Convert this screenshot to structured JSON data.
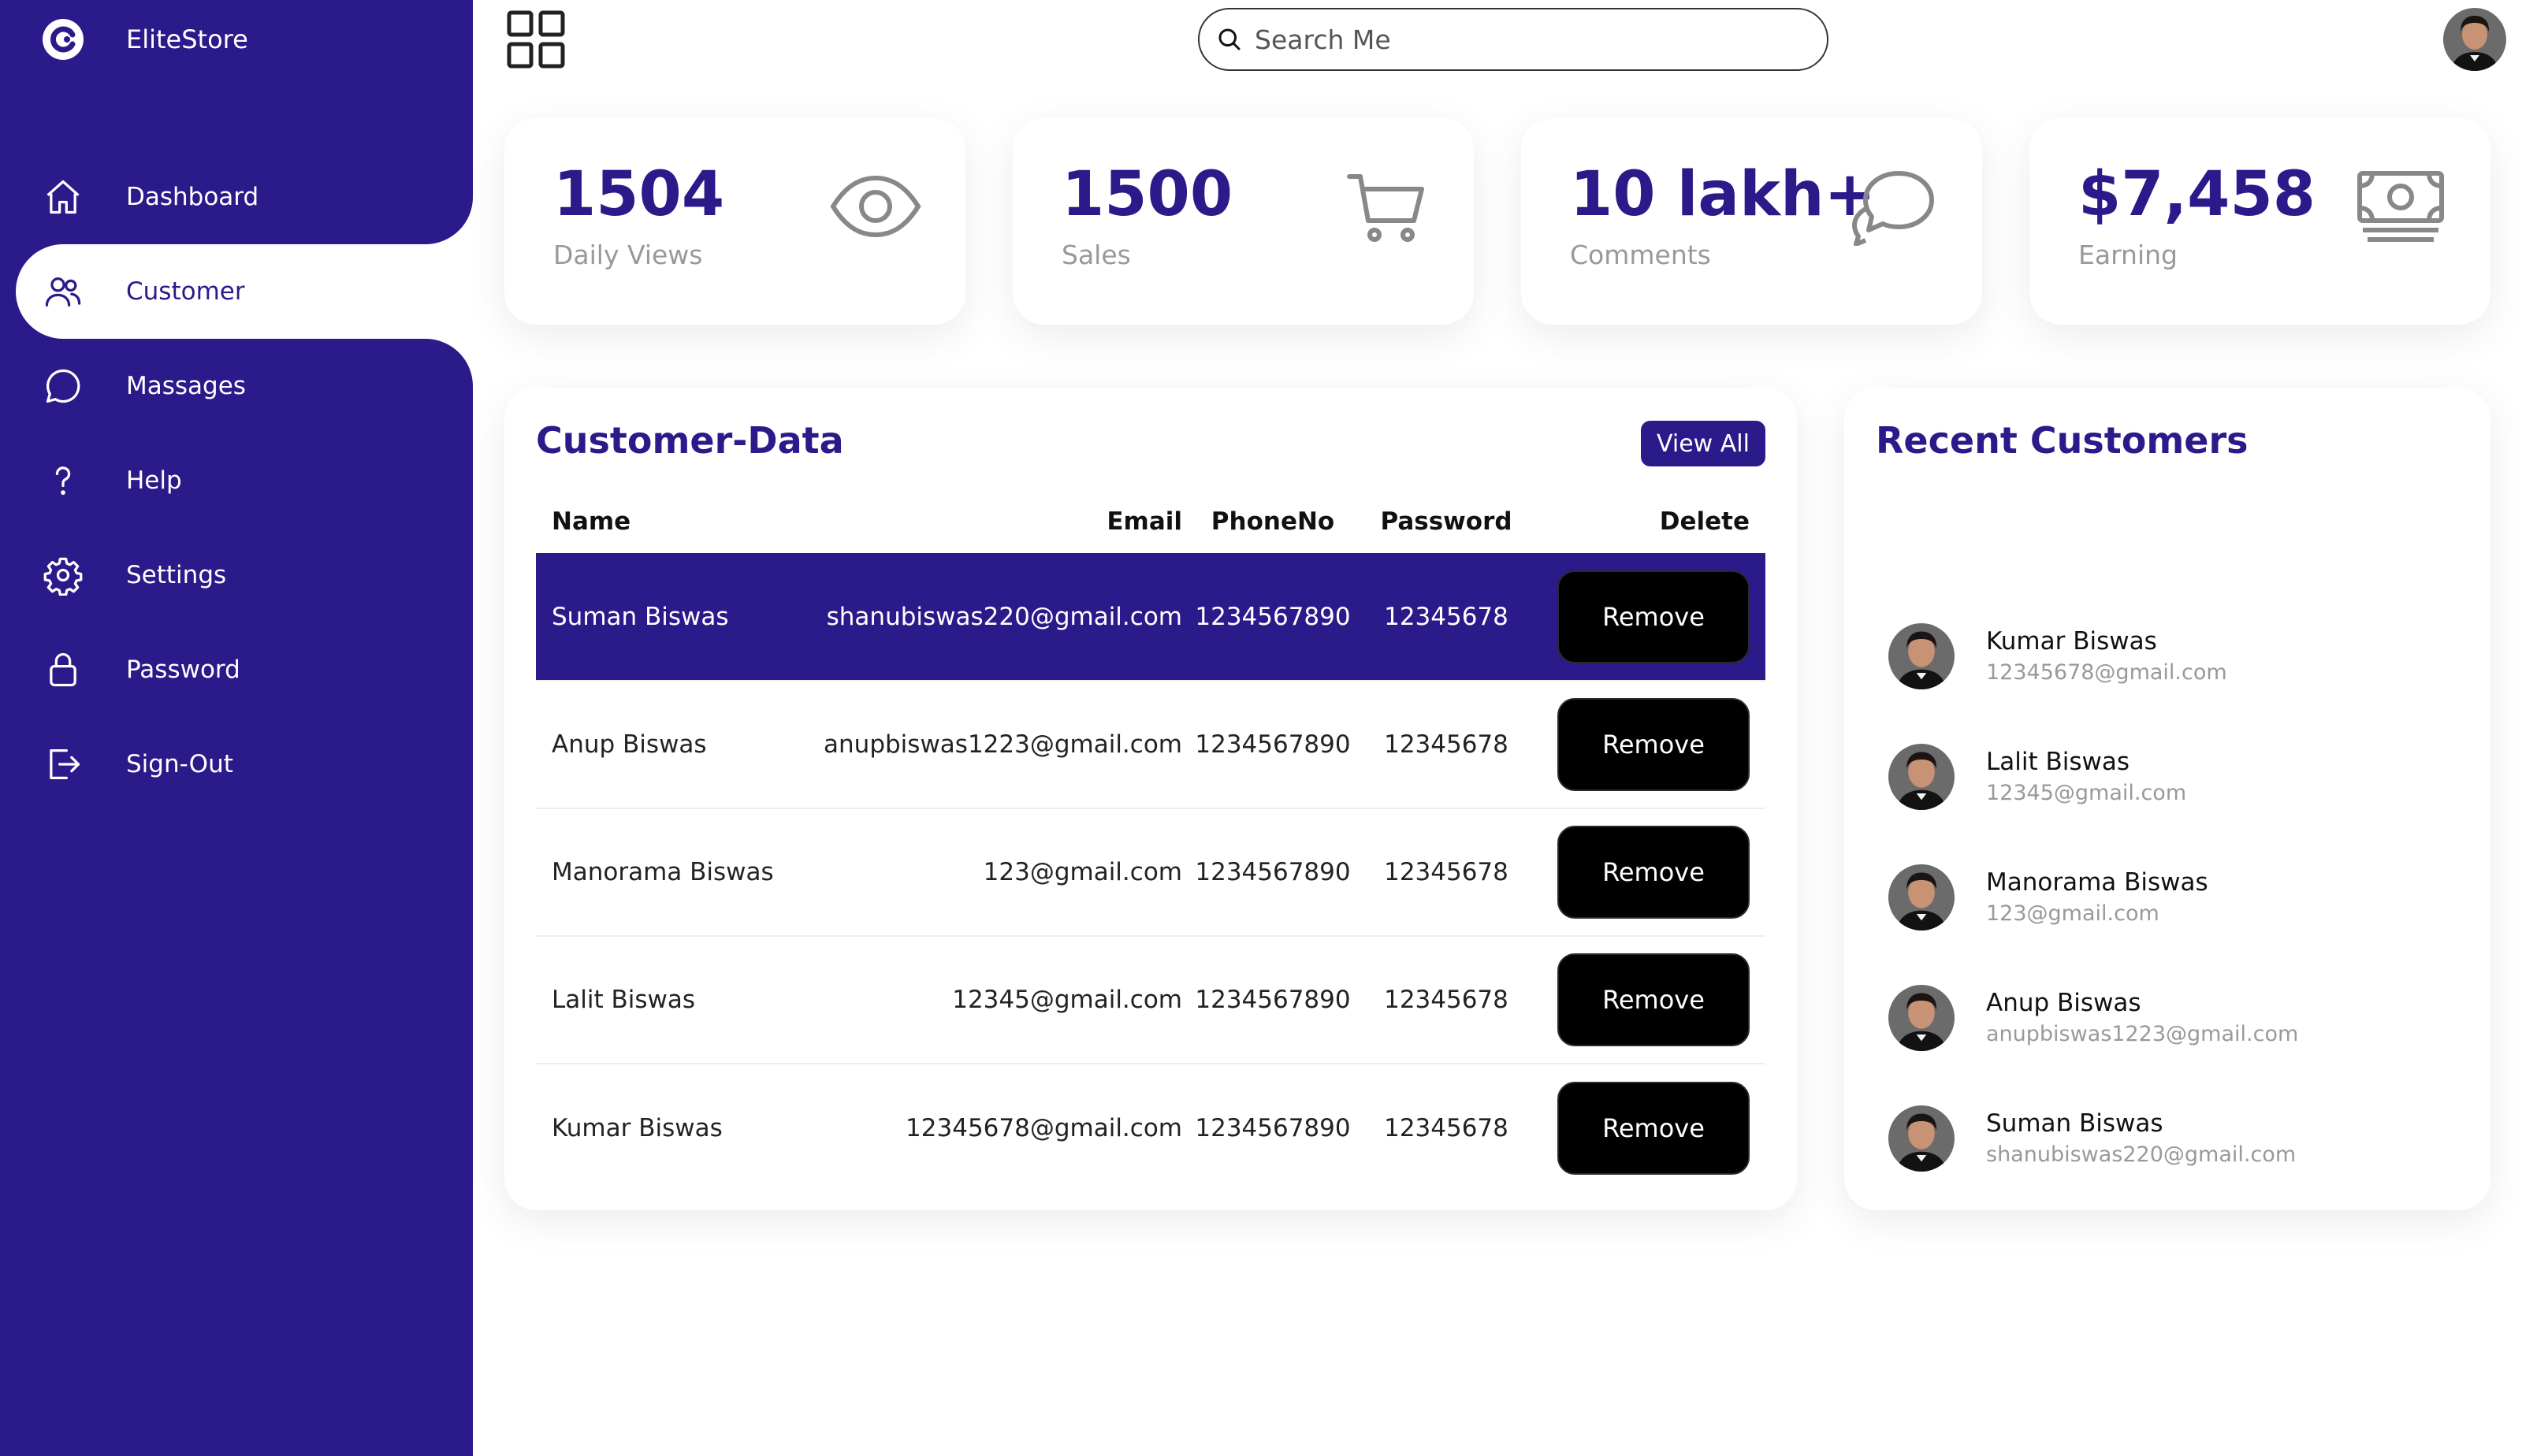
{
  "brand": {
    "name": "EliteStore"
  },
  "nav": [
    {
      "label": "Dashboard",
      "icon": "home-icon"
    },
    {
      "label": "Customer",
      "icon": "people-icon",
      "active": true
    },
    {
      "label": "Massages",
      "icon": "chat-bubble-icon"
    },
    {
      "label": "Help",
      "icon": "help-icon"
    },
    {
      "label": "Settings",
      "icon": "gear-icon"
    },
    {
      "label": "Password",
      "icon": "lock-icon"
    },
    {
      "label": "Sign-Out",
      "icon": "sign-out-icon"
    }
  ],
  "search": {
    "placeholder": "Search Me"
  },
  "cards": [
    {
      "value": "1504",
      "label": "Daily Views",
      "icon": "eye-icon"
    },
    {
      "value": "1500",
      "label": "Sales",
      "icon": "cart-icon"
    },
    {
      "value": "10 lakh+",
      "label": "Comments",
      "icon": "chat-bubbles-icon"
    },
    {
      "value": "$7,458",
      "label": "Earning",
      "icon": "cash-icon"
    }
  ],
  "customer_data": {
    "title": "Customer-Data",
    "view_all_label": "View All",
    "columns": [
      "Name",
      "Email",
      "PhoneNo",
      "Password",
      "Delete"
    ],
    "rows": [
      {
        "name": "Suman Biswas",
        "email": "shanubiswas220@gmail.com",
        "phone": "1234567890",
        "password": "12345678",
        "action": "Remove",
        "highlighted": true
      },
      {
        "name": "Anup Biswas",
        "email": "anupbiswas1223@gmail.com",
        "phone": "1234567890",
        "password": "12345678",
        "action": "Remove"
      },
      {
        "name": "Manorama Biswas",
        "email": "123@gmail.com",
        "phone": "1234567890",
        "password": "12345678",
        "action": "Remove"
      },
      {
        "name": "Lalit Biswas",
        "email": "12345@gmail.com",
        "phone": "1234567890",
        "password": "12345678",
        "action": "Remove"
      },
      {
        "name": "Kumar Biswas",
        "email": "12345678@gmail.com",
        "phone": "1234567890",
        "password": "12345678",
        "action": "Remove"
      }
    ]
  },
  "recent_customers": {
    "title": "Recent Customers",
    "items": [
      {
        "name": "Kumar Biswas",
        "email": "12345678@gmail.com"
      },
      {
        "name": "Lalit Biswas",
        "email": "12345@gmail.com"
      },
      {
        "name": "Manorama Biswas",
        "email": "123@gmail.com"
      },
      {
        "name": "Anup Biswas",
        "email": "anupbiswas1223@gmail.com"
      },
      {
        "name": "Suman Biswas",
        "email": "shanubiswas220@gmail.com"
      }
    ]
  },
  "colors": {
    "primary": "#2a1a8a",
    "background": "#ffffff",
    "button": "#000000",
    "muted_text": "#999999"
  }
}
